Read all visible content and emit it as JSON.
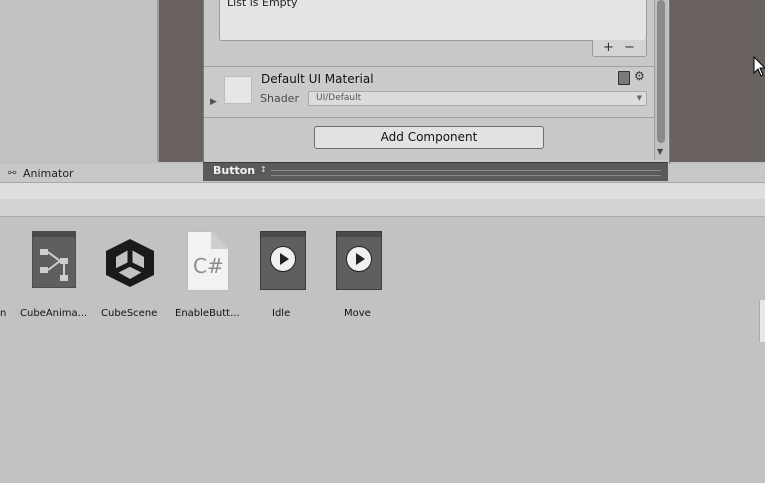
{
  "inspector": {
    "list_empty": "List is Empty",
    "plus": "+",
    "minus": "−",
    "material": {
      "name": "Default UI Material",
      "shader_label": "Shader",
      "shader_value": "UI/Default"
    },
    "add_component": "Add Component"
  },
  "titlebar": {
    "component": "Button",
    "arrows": "↕"
  },
  "animator_tab": {
    "title": "Animator"
  },
  "assets": [
    {
      "label": "n",
      "icon": "animation-icon"
    },
    {
      "label": "CubeAnima...",
      "icon": "animator-controller-icon"
    },
    {
      "label": "CubeScene",
      "icon": "unity-scene-icon"
    },
    {
      "label": "EnableButt...",
      "icon": "csharp-script-icon",
      "glyph": "C#"
    },
    {
      "label": "Idle",
      "icon": "animation-clip-icon"
    },
    {
      "label": "Move",
      "icon": "animation-clip-icon"
    }
  ],
  "colors": {
    "scene_bg": "#6a6260",
    "panel_bg": "#c2c2c2",
    "title_bar": "#5a5a5a"
  }
}
